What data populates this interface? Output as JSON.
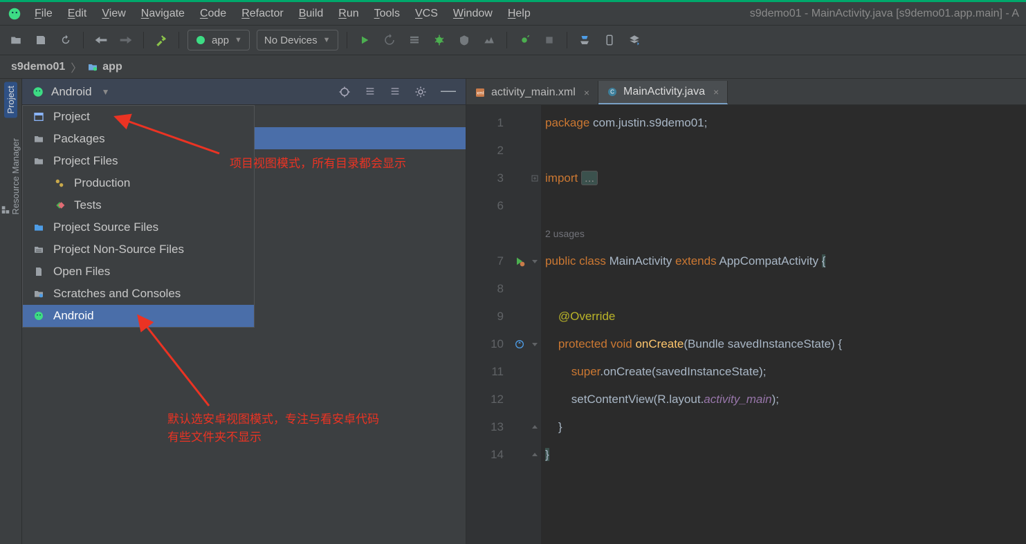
{
  "menu": {
    "items": [
      "File",
      "Edit",
      "View",
      "Navigate",
      "Code",
      "Refactor",
      "Build",
      "Run",
      "Tools",
      "VCS",
      "Window",
      "Help"
    ],
    "title": "s9demo01 - MainActivity.java [s9demo01.app.main] - A"
  },
  "toolbar": {
    "config": "app",
    "device": "No Devices"
  },
  "breadcrumb": {
    "root": "s9demo01",
    "module": "app"
  },
  "sidebar": {
    "tabs": [
      "Project",
      "Resource Manager"
    ]
  },
  "proj_header": {
    "label": "Android"
  },
  "dropdown": {
    "items": [
      {
        "label": "Project",
        "icon": "window"
      },
      {
        "label": "Packages",
        "icon": "folder"
      },
      {
        "label": "Project Files",
        "icon": "folder"
      },
      {
        "label": "Production",
        "icon": "cogs",
        "indent": true
      },
      {
        "label": "Tests",
        "icon": "diamond",
        "indent": true
      },
      {
        "label": "Project Source Files",
        "icon": "folder-blue"
      },
      {
        "label": "Project Non-Source Files",
        "icon": "folder-lines"
      },
      {
        "label": "Open Files",
        "icon": "file"
      },
      {
        "label": "Scratches and Consoles",
        "icon": "folder-clock"
      },
      {
        "label": "Android",
        "icon": "android",
        "selected": true
      }
    ]
  },
  "annotations": {
    "top": "项目视图模式，所有目录都会显示",
    "bottom1": "默认选安卓视图模式，专注与看安卓代码",
    "bottom2": "有些文件夹不显示"
  },
  "tabs": [
    {
      "label": "activity_main.xml",
      "icon": "xml"
    },
    {
      "label": "MainActivity.java",
      "icon": "class",
      "active": true
    }
  ],
  "code": {
    "lines": [
      {
        "n": "1",
        "html": "<span class='k'>package</span> com.justin.s9demo01<span class='s'>;</span>"
      },
      {
        "n": "2",
        "html": ""
      },
      {
        "n": "3",
        "html": "<span class='k'>import</span> <span class='fold'>...</span>",
        "fold": "+"
      },
      {
        "n": "6",
        "html": ""
      },
      {
        "n": "",
        "html": "<span class='hint'>2 usages</span>"
      },
      {
        "n": "7",
        "html": "<span class='k'>public class</span> <span class='t'>MainActivity</span> <span class='k'>extends</span> <span class='t'>AppCompatActivity</span> <span class='brace-hl'>{</span>",
        "gic": "run",
        "fold": "-"
      },
      {
        "n": "8",
        "html": ""
      },
      {
        "n": "9",
        "html": "    <span class='a'>@Override</span>"
      },
      {
        "n": "10",
        "html": "    <span class='k'>protected void</span> <span class='m'>onCreate</span>(Bundle savedInstanceState) {",
        "gic": "override",
        "fold": "-"
      },
      {
        "n": "11",
        "html": "        <span class='k'>super</span>.onCreate(savedInstanceState);"
      },
      {
        "n": "12",
        "html": "        setContentView(R.layout.<span class='i'>activity_main</span>);"
      },
      {
        "n": "13",
        "html": "    }",
        "fold": "^"
      },
      {
        "n": "14",
        "html": "<span class='brace-hl'>}</span>",
        "fold": "^"
      }
    ]
  }
}
